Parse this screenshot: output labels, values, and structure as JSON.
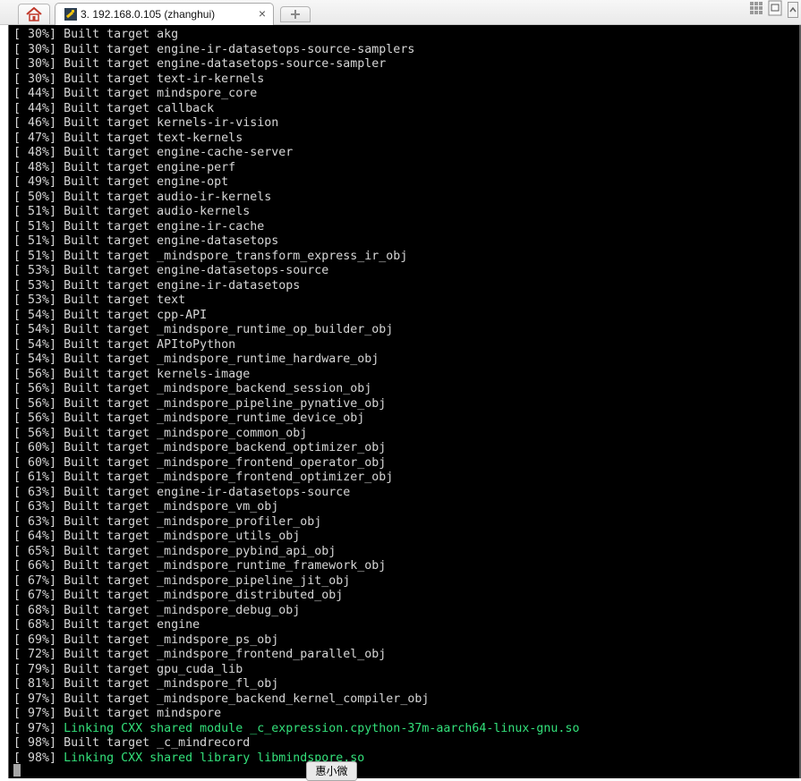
{
  "tabs": {
    "home_icon": "home-icon",
    "session_title": "3. 192.168.0.105 (zhanghui)",
    "close_glyph": "×",
    "new_tab_glyph": "+"
  },
  "colors": {
    "terminal_bg": "#000000",
    "terminal_text": "#d6d6d6",
    "link_text": "#33e07a"
  },
  "terminal": {
    "lines": [
      {
        "percent": "[ 30%]",
        "text": "Built target akg"
      },
      {
        "percent": "[ 30%]",
        "text": "Built target engine-ir-datasetops-source-samplers"
      },
      {
        "percent": "[ 30%]",
        "text": "Built target engine-datasetops-source-sampler"
      },
      {
        "percent": "[ 30%]",
        "text": "Built target text-ir-kernels"
      },
      {
        "percent": "[ 44%]",
        "text": "Built target mindspore_core"
      },
      {
        "percent": "[ 44%]",
        "text": "Built target callback"
      },
      {
        "percent": "[ 46%]",
        "text": "Built target kernels-ir-vision"
      },
      {
        "percent": "[ 47%]",
        "text": "Built target text-kernels"
      },
      {
        "percent": "[ 48%]",
        "text": "Built target engine-cache-server"
      },
      {
        "percent": "[ 48%]",
        "text": "Built target engine-perf"
      },
      {
        "percent": "[ 49%]",
        "text": "Built target engine-opt"
      },
      {
        "percent": "[ 50%]",
        "text": "Built target audio-ir-kernels"
      },
      {
        "percent": "[ 51%]",
        "text": "Built target audio-kernels"
      },
      {
        "percent": "[ 51%]",
        "text": "Built target engine-ir-cache"
      },
      {
        "percent": "[ 51%]",
        "text": "Built target engine-datasetops"
      },
      {
        "percent": "[ 51%]",
        "text": "Built target _mindspore_transform_express_ir_obj"
      },
      {
        "percent": "[ 53%]",
        "text": "Built target engine-datasetops-source"
      },
      {
        "percent": "[ 53%]",
        "text": "Built target engine-ir-datasetops"
      },
      {
        "percent": "[ 53%]",
        "text": "Built target text"
      },
      {
        "percent": "[ 54%]",
        "text": "Built target cpp-API"
      },
      {
        "percent": "[ 54%]",
        "text": "Built target _mindspore_runtime_op_builder_obj"
      },
      {
        "percent": "[ 54%]",
        "text": "Built target APItoPython"
      },
      {
        "percent": "[ 54%]",
        "text": "Built target _mindspore_runtime_hardware_obj"
      },
      {
        "percent": "[ 56%]",
        "text": "Built target kernels-image"
      },
      {
        "percent": "[ 56%]",
        "text": "Built target _mindspore_backend_session_obj"
      },
      {
        "percent": "[ 56%]",
        "text": "Built target _mindspore_pipeline_pynative_obj"
      },
      {
        "percent": "[ 56%]",
        "text": "Built target _mindspore_runtime_device_obj"
      },
      {
        "percent": "[ 56%]",
        "text": "Built target _mindspore_common_obj"
      },
      {
        "percent": "[ 60%]",
        "text": "Built target _mindspore_backend_optimizer_obj"
      },
      {
        "percent": "[ 60%]",
        "text": "Built target _mindspore_frontend_operator_obj"
      },
      {
        "percent": "[ 61%]",
        "text": "Built target _mindspore_frontend_optimizer_obj"
      },
      {
        "percent": "[ 63%]",
        "text": "Built target engine-ir-datasetops-source"
      },
      {
        "percent": "[ 63%]",
        "text": "Built target _mindspore_vm_obj"
      },
      {
        "percent": "[ 63%]",
        "text": "Built target _mindspore_profiler_obj"
      },
      {
        "percent": "[ 64%]",
        "text": "Built target _mindspore_utils_obj"
      },
      {
        "percent": "[ 65%]",
        "text": "Built target _mindspore_pybind_api_obj"
      },
      {
        "percent": "[ 66%]",
        "text": "Built target _mindspore_runtime_framework_obj"
      },
      {
        "percent": "[ 67%]",
        "text": "Built target _mindspore_pipeline_jit_obj"
      },
      {
        "percent": "[ 67%]",
        "text": "Built target _mindspore_distributed_obj"
      },
      {
        "percent": "[ 68%]",
        "text": "Built target _mindspore_debug_obj"
      },
      {
        "percent": "[ 68%]",
        "text": "Built target engine"
      },
      {
        "percent": "[ 69%]",
        "text": "Built target _mindspore_ps_obj"
      },
      {
        "percent": "[ 72%]",
        "text": "Built target _mindspore_frontend_parallel_obj"
      },
      {
        "percent": "[ 79%]",
        "text": "Built target gpu_cuda_lib"
      },
      {
        "percent": "[ 81%]",
        "text": "Built target _mindspore_fl_obj"
      },
      {
        "percent": "[ 97%]",
        "text": "Built target _mindspore_backend_kernel_compiler_obj"
      },
      {
        "percent": "[ 97%]",
        "text": "Built target mindspore"
      },
      {
        "percent": "[ 97%]",
        "text": "Linking CXX shared module _c_expression.cpython-37m-aarch64-linux-gnu.so",
        "link": true
      },
      {
        "percent": "[ 98%]",
        "text": "Built target _c_mindrecord"
      },
      {
        "percent": "[ 98%]",
        "text": "Linking CXX shared library libmindspore.so",
        "link": true
      }
    ]
  },
  "tooltip": {
    "text": "惠小微"
  }
}
